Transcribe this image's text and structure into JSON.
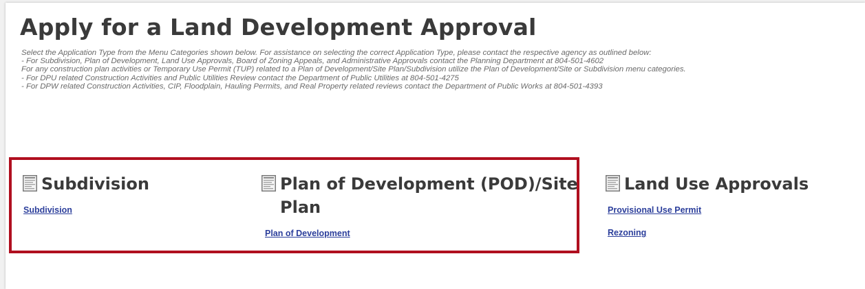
{
  "page": {
    "title": "Apply for a Land Development Approval",
    "instructions": [
      "Select the Application Type from the Menu Categories shown below. For assistance on selecting the correct Application Type, please contact the respective agency as outlined below:",
      "- For Subdivision, Plan of Development, Land Use Approvals, Board of Zoning Appeals, and Administrative Approvals contact the Planning Department at 804-501-4602",
      "For any construction plan activities or Temporary Use Permit (TUP) related to a Plan of Development/Site Plan/Subdivision utilize the Plan of Development/Site or Subdivision menu categories.",
      "- For DPU related Construction Activities and Public Utilities Review contact the Department of Public Utilities at 804-501-4275",
      "- For DPW related Construction Activities, CIP, Floodplain, Hauling Permits, and Real Property related reviews contact the Department of Public Works at 804-501-4393"
    ]
  },
  "categories": {
    "subdivision": {
      "icon": "document-icon",
      "heading": "Subdivision",
      "links": [
        "Subdivision"
      ]
    },
    "pod": {
      "icon": "document-icon",
      "heading": "Plan of Development (POD)/Site Plan",
      "links": [
        "Plan of Development"
      ]
    },
    "land_use": {
      "icon": "document-icon",
      "heading": "Land Use Approvals",
      "links": [
        "Provisional Use Permit",
        "Rezoning"
      ]
    }
  },
  "colors": {
    "heading": "#3a3a3a",
    "body_text": "#6a6a6a",
    "link": "#2b3e9b",
    "highlight_border": "#b00f1f"
  }
}
